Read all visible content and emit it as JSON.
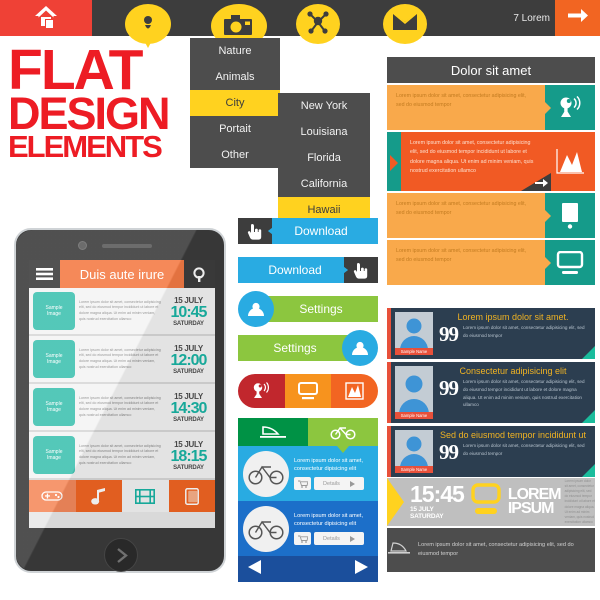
{
  "topnav": {
    "bg": "#3d3d3d",
    "home_icon": "home-icon",
    "pin_icon": "location-pin-icon",
    "camera_icon": "camera-pin-icon",
    "share_icon": "share-network-icon",
    "mail_icon": "envelope-icon",
    "label": "7 Lorem",
    "arrow_icon": "arrow-right-icon",
    "home_bg": "#ef4136",
    "arrow_bg": "#f26522",
    "accent_yellow": "#ffd21f"
  },
  "title": {
    "line1": "FLAT",
    "line2": "DESIGN",
    "line3": "ELEMENTS",
    "color": "#ed1c24"
  },
  "menu": {
    "primary": [
      {
        "label": "Nature",
        "selected": false
      },
      {
        "label": "Animals",
        "selected": false
      },
      {
        "label": "City",
        "selected": true
      },
      {
        "label": "Portait",
        "selected": false
      },
      {
        "label": "Other",
        "selected": false
      }
    ],
    "secondary": [
      {
        "label": "New York",
        "selected": false
      },
      {
        "label": "Louisiana",
        "selected": false
      },
      {
        "label": "Florida",
        "selected": false
      },
      {
        "label": "California",
        "selected": false
      },
      {
        "label": "Hawaii",
        "selected": true
      }
    ],
    "bg": "#4d4d4d",
    "selected_bg": "#ffd21f"
  },
  "phone": {
    "menu_icon": "hamburger-menu-icon",
    "search_icon": "search-icon",
    "title": "Duis aute irure",
    "title_bg": "#f47b45",
    "thumb_label": "Sample\nImage",
    "body_text": "Lorem ipsum dolor sit amet, consectetur adipisicing elit, sed do eiusmod tempor incididunt ut labore et dolore magna aliqua. Ut enim ad minim veniam, quis nostrud exercitation ullamco",
    "rows": [
      {
        "date": "15 JULY",
        "time": "10:45",
        "day": "SATURDAY"
      },
      {
        "date": "15 JULY",
        "time": "12:00",
        "day": "SATURDAY"
      },
      {
        "date": "15 JULY",
        "time": "14:30",
        "day": "SATURDAY"
      },
      {
        "date": "15 JULY",
        "time": "18:15",
        "day": "SATURDAY"
      }
    ],
    "tray": [
      {
        "icon": "gamepad-icon",
        "bg": "#f58a5c",
        "fg": "#ffffff"
      },
      {
        "icon": "music-note-icon",
        "bg": "#f26522",
        "fg": "#ffffff"
      },
      {
        "icon": "film-strip-icon",
        "bg": "#f4f4f4",
        "fg": "#19b5a5"
      },
      {
        "icon": "book-icon",
        "bg": "#f26522",
        "fg": "#f9b08a"
      }
    ],
    "home_button_icon": "chevron-right-icon",
    "accent": "#19b5a5"
  },
  "buttons": [
    {
      "label": "Download",
      "bar_bg": "#29abe2",
      "tag_bg": "#3d3d3d",
      "icon": "hand-pointer-icon",
      "side": "left",
      "shape": "tag"
    },
    {
      "label": "Download",
      "bar_bg": "#29abe2",
      "tag_bg": "#3d3d3d",
      "icon": "hand-pointer-icon",
      "side": "right",
      "shape": "tag"
    },
    {
      "label": "Settings",
      "bar_bg": "#8cc63f",
      "tag_bg": "#29abe2",
      "icon": "user-circle-icon",
      "side": "left",
      "shape": "circle"
    },
    {
      "label": "Settings",
      "bar_bg": "#8cc63f",
      "tag_bg": "#29abe2",
      "icon": "user-circle-icon",
      "side": "right",
      "shape": "circle"
    }
  ],
  "icon_strip": [
    {
      "icon": "satellite-icon",
      "bg": "#c1272d"
    },
    {
      "icon": "monitor-icon",
      "bg": "#f7931e"
    },
    {
      "icon": "chart-icon",
      "bg": "#f26522"
    }
  ],
  "bike": {
    "tabs": [
      {
        "icon": "boat-icon",
        "bg": "#009245",
        "active": false
      },
      {
        "icon": "bicycle-icon",
        "bg": "#8cc63f",
        "active": true
      }
    ],
    "cards": [
      {
        "icon": "bicycle-icon",
        "text": "Lorem ipsum dolor sit amet, consectetur dipisicing elit",
        "bg": "#29abe2",
        "cart_icon": "cart-icon",
        "details_label": "Details",
        "details_icon": "play-icon"
      },
      {
        "icon": "bicycle-icon",
        "text": "Lorem ipsum dolor sit amet, consectetur dipisicing elit",
        "bg": "#1c6fc9",
        "cart_icon": "cart-icon",
        "details_label": "Details",
        "details_icon": "play-icon"
      }
    ],
    "prev_icon": "triangle-left-icon",
    "next_icon": "triangle-right-icon",
    "nav_bg": "#1b4f9c"
  },
  "dolor": {
    "heading": "Dolor sit amet",
    "heading_bg": "#4d4d4d",
    "rows": [
      {
        "text": "Lorem ipsum dolor sit amet, consectetur adipisicing elit, sed do eiusmod tempor",
        "text_bg": "#f9a94b",
        "icon_bg": "#159b8a",
        "icon": "satellite-dish-icon",
        "highlight": false
      },
      {
        "text": "Lorem ipsum dolor sit amet, consectetur adipisicing elit, sed do eiusmod tempor incididunt ut labore et dolore magna aliqua. Ut enim ad minim veniam, quis nostrud exercitation ullamco",
        "text_bg": "#f15a24",
        "icon_bg": "#f15a24",
        "icon": "mountain-chart-icon",
        "highlight": true,
        "badge_icon": "arrow-right-icon"
      },
      {
        "text": "Lorem ipsum dolor sit amet, consectetur adipisicing elit, sed do eiusmod tempor",
        "text_bg": "#f9a94b",
        "icon_bg": "#159b8a",
        "icon": "tablet-icon",
        "highlight": false
      },
      {
        "text": "Lorem ipsum dolor sit amet, consectetur adipisicing elit, sed do eiusmod tempor",
        "text_bg": "#f9a94b",
        "icon_bg": "#159b8a",
        "icon": "monitor-icon",
        "highlight": false
      }
    ]
  },
  "testimonials": [
    {
      "title": "Lorem ipsum dolor sit amet.",
      "avatar_icon": "user-avatar-icon",
      "name": "Sample Name",
      "quote_glyph": "99",
      "text": "Lorem ipsum dolor sit amet, consectetur adipisicing elit, sed do eiusmod tempor"
    },
    {
      "title": "Consectetur adipisicing elit",
      "avatar_icon": "user-avatar-icon",
      "name": "Sample Name",
      "quote_glyph": "99",
      "text": "Lorem ipsum dolor sit amet, consectetur adipisicing elit, sed do eiusmod tempor incididunt ut labore et dolore magna aliqua. Ut enim ad minim veniam, quis nostrud exercitation ullamco"
    },
    {
      "title": "Sed do eiusmod tempor incididunt ut",
      "avatar_icon": "user-avatar-icon",
      "name": "Sample Name",
      "quote_glyph": "99",
      "text": "Lorem ipsum dolor sit amet, consectetur adipisicing elit, sed do eiusmod tempor"
    }
  ],
  "testimonial_style": {
    "bg": "#2c3e50",
    "stripe": "#e8503a",
    "title_color": "#f0b323",
    "corner": "#1abc9c"
  },
  "clock": {
    "time": "15:45",
    "date": "15 JULY SATURDAY",
    "brand_line1": "LOREM",
    "brand_line2": "IPSUM",
    "monitor_icon": "monitor-icon",
    "micro_text": "Lorem ipsum dolor sit amet, consectetur adipisicing elit, sed do eiusmod tempor incididunt ut labore et dolore magna aliqua. Ut enim ad minim veniam, quis nostrud exercitation ullamco",
    "bg": "#bfbfbf",
    "accent": "#ffd21f"
  },
  "laptop_bar": {
    "icon": "laptop-icon",
    "text": "Lorem ipsum dolor sit amet, consectetur adipisicing elit, sed do eiusmod tempor",
    "bg": "#4d4d4d"
  }
}
